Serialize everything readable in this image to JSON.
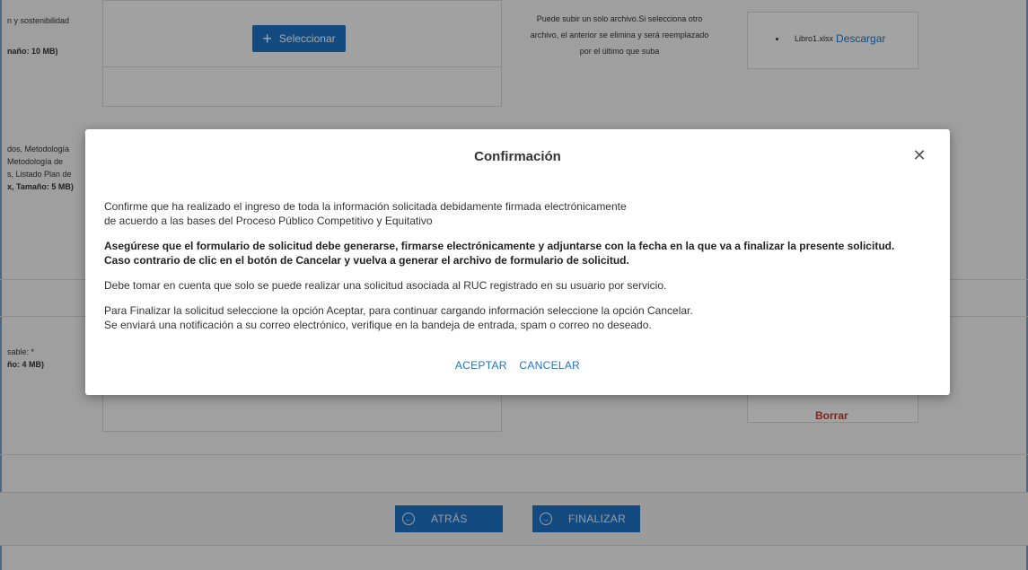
{
  "background": {
    "left_labels": {
      "block1_line1": "n y sostenibilidad",
      "block1_line2": "naño: 10 MB)",
      "block2_line1": "dos, Metodología",
      "block2_line2": "Metodología de",
      "block2_line3": "s, Listado Plan de",
      "block2_line4": "x, Tamaño: 5 MB)",
      "block3_line1": "sable: *",
      "block3_line2": "ño: 4 MB)"
    },
    "select_button_label": "Seleccionar",
    "help_text": {
      "line1": "Puede subir un solo archivo.Si selecciona otro",
      "line2": "archivo, el anterior se elimina y será reemplazado",
      "line3": "por el último que suba"
    },
    "file": {
      "name": "Libro1.xlsx",
      "download_label": "Descargar"
    },
    "delete_label": "Borrar",
    "nav": {
      "back_label": "ATRÁS",
      "finish_label": "FINALIZAR"
    }
  },
  "modal": {
    "title": "Confirmación",
    "para1_line1": "Confirme que ha realizado el ingreso de toda la información solicitada debidamente firmada electrónicamente",
    "para1_line2": "de acuerdo a las bases del Proceso Público Competitivo y Equitativo",
    "para2_line1": "Asegúrese que el formulario de solicitud debe generarse, firmarse electrónicamente y adjuntarse con la fecha en la que va a finalizar la presente solicitud.",
    "para2_line2": "Caso contrario de clic en el botón de Cancelar y vuelva a generar el archivo de formulario de solicitud.",
    "para3": "Debe tomar en cuenta que solo se puede realizar una solicitud asociada al RUC registrado en su usuario por servicio.",
    "para4_line1": "Para Finalizar la solicitud seleccione la opción Aceptar, para continuar cargando información seleccione la opción Cancelar.",
    "para4_line2": "Se enviará una notificación a su correo electrónico, verifique en la bandeja de entrada, spam o correo no deseado.",
    "accept_label": "ACEPTAR",
    "cancel_label": "CANCELAR"
  },
  "colors": {
    "primary": "#1e74c6",
    "danger": "#c0392b",
    "overlay": "rgba(0,0,0,0.35)"
  }
}
